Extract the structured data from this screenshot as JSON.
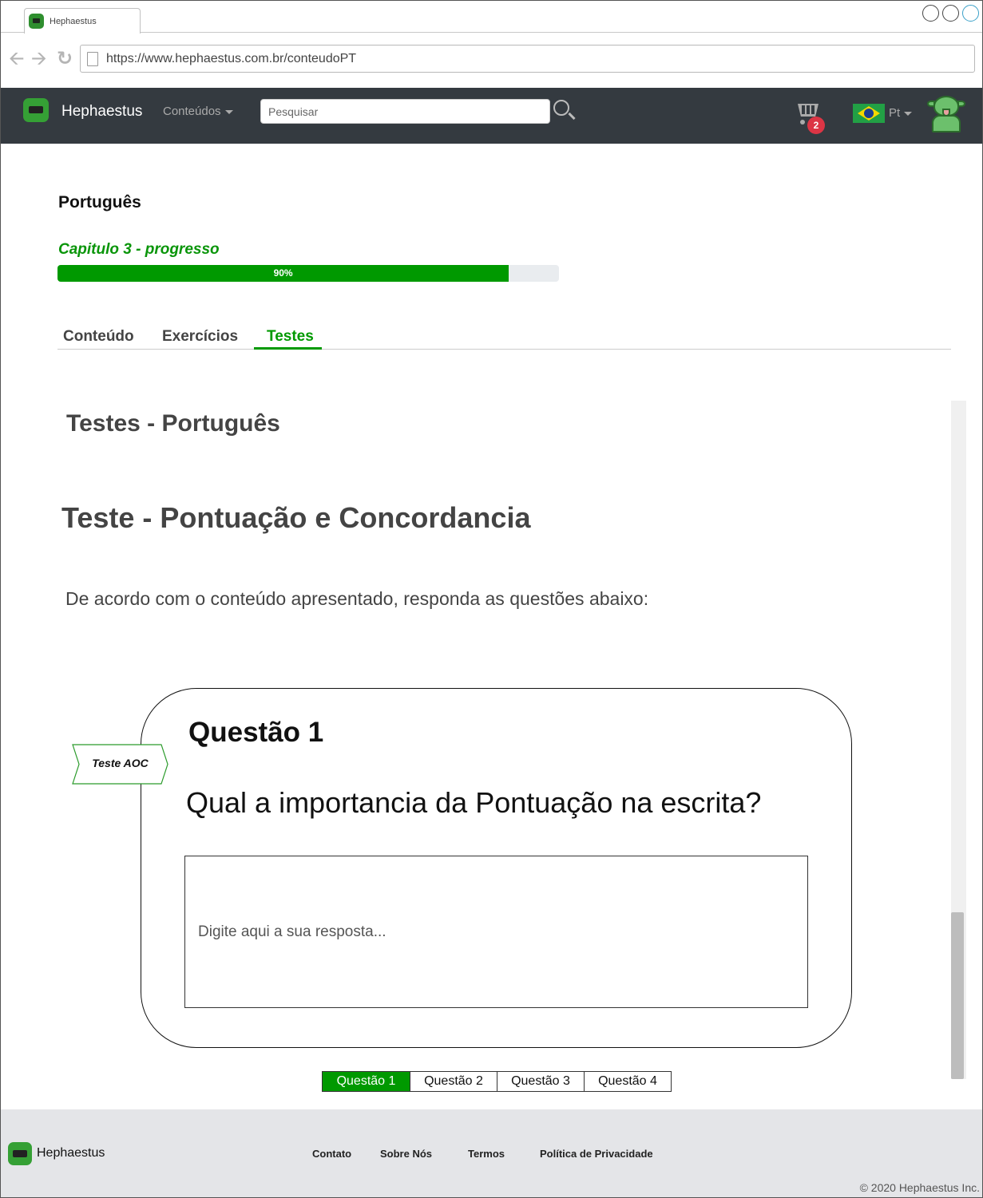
{
  "browser": {
    "tab_title": "Hephaestus",
    "url": "https://www.hephaestus.com.br/conteudoPT"
  },
  "navbar": {
    "brand": "Hephaestus",
    "menu_label": "Conteúdos",
    "search_placeholder": "Pesquisar",
    "cart_count": "2",
    "language": "Pt"
  },
  "course": {
    "subject": "Português",
    "chapter_label": "Capitulo 3 - progresso",
    "progress_text": "90%",
    "progress_value": 0.9,
    "tabs": [
      "Conteúdo",
      "Exercícios",
      "Testes"
    ],
    "active_tab": "Testes"
  },
  "tests": {
    "section_title": "Testes - Português",
    "test_title": "Teste - Pontuação e Concordancia",
    "intro": "De acordo com o conteúdo apresentado, responda as questões abaixo:",
    "question": {
      "title": "Questão 1",
      "tag": "Teste AOC",
      "text": "Qual a importancia da Pontuação na escrita?",
      "answer_placeholder": "Digite aqui a sua resposta..."
    },
    "pager": [
      "Questão 1",
      "Questão 2",
      "Questão 3",
      "Questão 4"
    ],
    "active_page": "Questão 1"
  },
  "footer": {
    "brand": "Hephaestus",
    "links": [
      "Contato",
      "Sobre Nós",
      "Termos",
      "Política de Privacidade"
    ],
    "copyright": "© 2020 Hephaestus Inc."
  },
  "colors": {
    "accent": "#009900",
    "navbar": "#343a40",
    "badge": "#dc3545"
  }
}
